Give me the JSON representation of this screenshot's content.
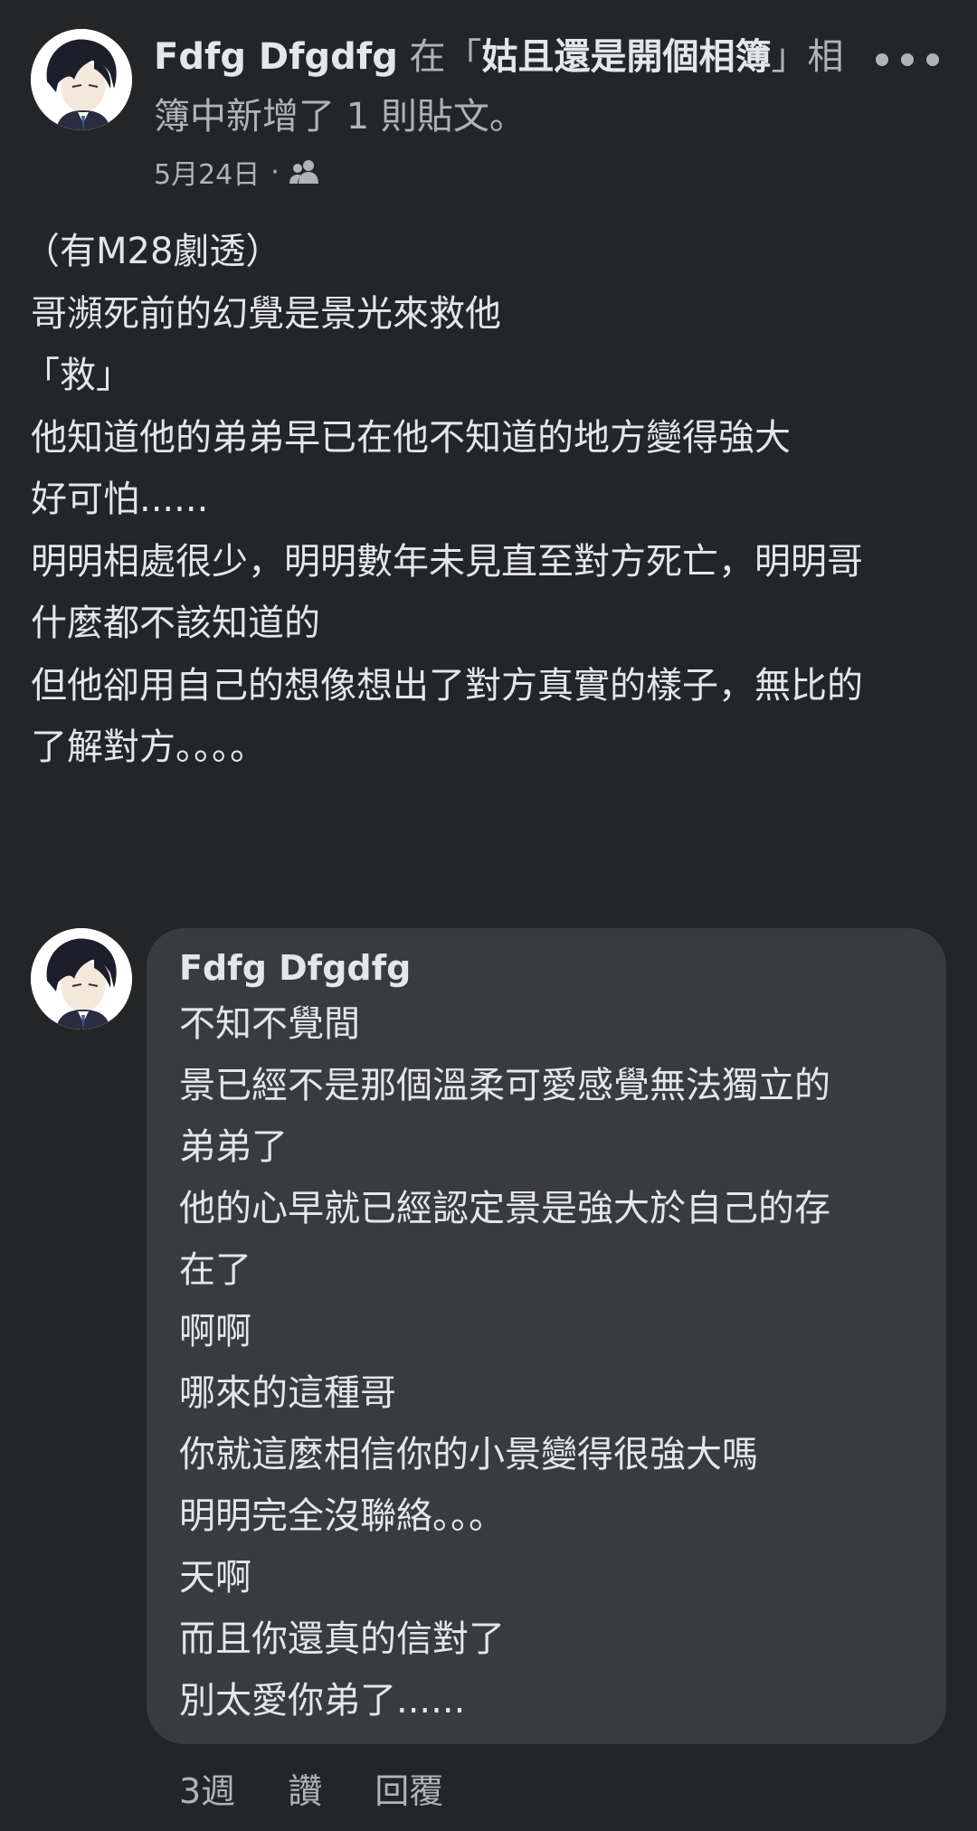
{
  "post": {
    "author": "Fdfg Dfgdfg",
    "action_prefix": " 在「",
    "album_name": "姑且還是開個相簿",
    "action_suffix_line1": "」相",
    "action_line2": "簿中新增了 1 則貼文。",
    "date": "5月24日",
    "separator": "·",
    "audience_icon": "friends-icon",
    "more_icon": "more-horizontal-icon",
    "body_lines": [
      "（有M28劇透）",
      "哥瀕死前的幻覺是景光來救他",
      "「救」",
      "他知道他的弟弟早已在他不知道的地方變得強大",
      "好可怕......",
      "明明相處很少，明明數年未見直至對方死亡，明明哥",
      "什麼都不該知道的",
      "但他卻用自己的想像想出了對方真實的樣子，無比的",
      "了解對方。。。。"
    ]
  },
  "comment": {
    "author": "Fdfg Dfgdfg",
    "lines": [
      "不知不覺間",
      "景已經不是那個溫柔可愛感覺無法獨立的",
      "弟弟了",
      "他的心早就已經認定景是強大於自己的存",
      "在了",
      "啊啊",
      "哪來的這種哥",
      "你就這麼相信你的小景變得很強大嗎",
      "明明完全沒聯絡。。。",
      "天啊",
      "而且你還真的信對了",
      "別太愛你弟了......"
    ],
    "time": "3週",
    "like_label": "讚",
    "reply_label": "回覆"
  },
  "colors": {
    "background": "#242526",
    "bubble": "#3a3b3c",
    "primary_text": "#e4e6eb",
    "secondary_text": "#b0b3b8"
  }
}
